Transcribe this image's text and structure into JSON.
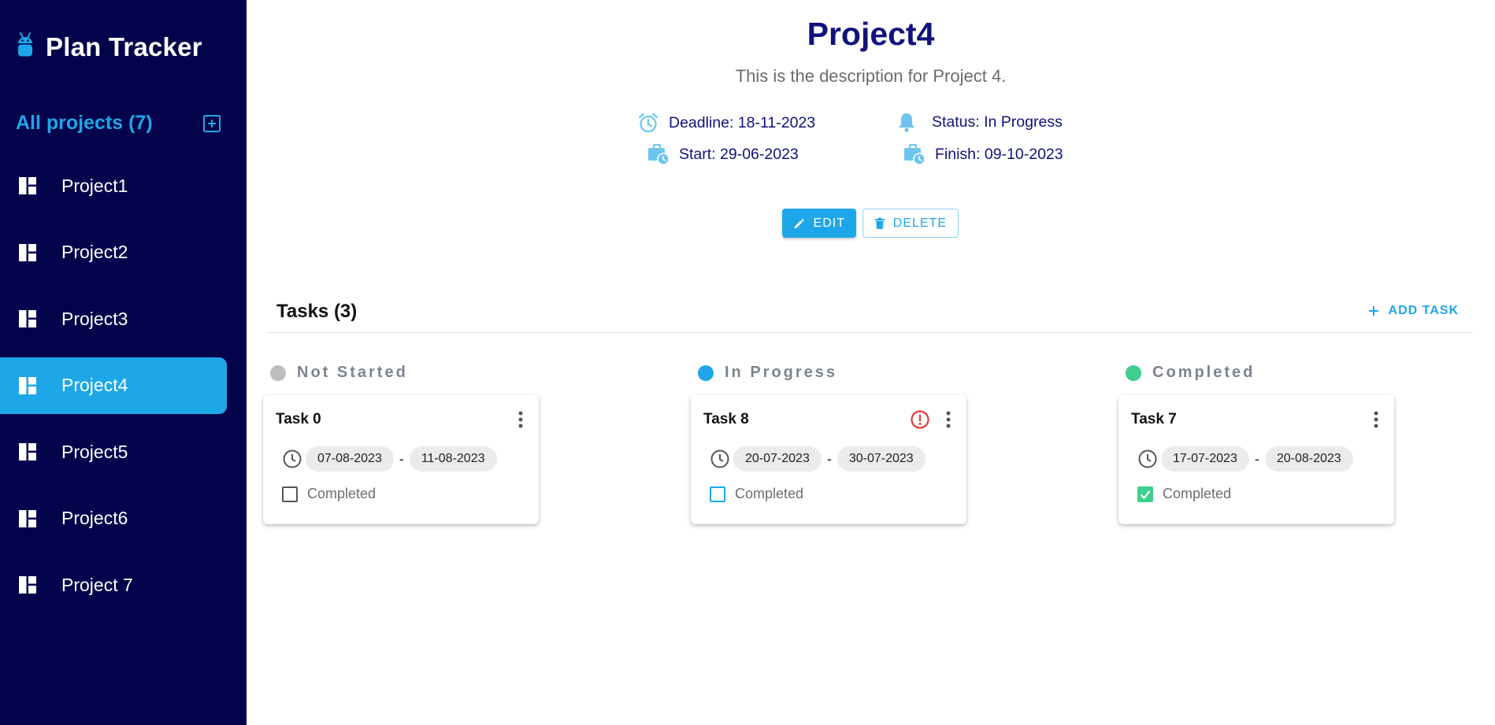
{
  "app": {
    "title": "Plan Tracker"
  },
  "sidebar": {
    "all_projects_label": "All projects (7)",
    "items": [
      {
        "label": "Project1",
        "active": false
      },
      {
        "label": "Project2",
        "active": false
      },
      {
        "label": "Project3",
        "active": false
      },
      {
        "label": "Project4",
        "active": true
      },
      {
        "label": "Project5",
        "active": false
      },
      {
        "label": "Project6",
        "active": false
      },
      {
        "label": "Project 7",
        "active": false
      }
    ]
  },
  "project": {
    "title": "Project4",
    "description": "This is the description for Project 4.",
    "deadline": "Deadline: 18-11-2023",
    "status": "Status: In Progress",
    "start": "Start: 29-06-2023",
    "finish": "Finish: 09-10-2023"
  },
  "actions": {
    "edit": "EDIT",
    "delete": "DELETE"
  },
  "tasks": {
    "title": "Tasks (3)",
    "add_label": "ADD TASK",
    "columns": [
      {
        "label": "Not Started",
        "color": "#bdbdbd",
        "card": {
          "title": "Task 0",
          "start": "07-08-2023",
          "end": "11-08-2023",
          "check_label": "Completed",
          "checked": false,
          "alert": false
        }
      },
      {
        "label": "In Progress",
        "color": "#1ea7e8",
        "card": {
          "title": "Task 8",
          "start": "20-07-2023",
          "end": "30-07-2023",
          "check_label": "Completed",
          "checked": false,
          "alert": true
        }
      },
      {
        "label": "Completed",
        "color": "#3ecf8e",
        "card": {
          "title": "Task 7",
          "start": "17-07-2023",
          "end": "20-08-2023",
          "check_label": "Completed",
          "checked": true,
          "alert": false
        }
      }
    ]
  },
  "colors": {
    "sidebar_bg": "#02034a",
    "accent": "#1ea7e8",
    "title": "#11117e",
    "alert": "#e53935",
    "success": "#3ecf8e"
  }
}
